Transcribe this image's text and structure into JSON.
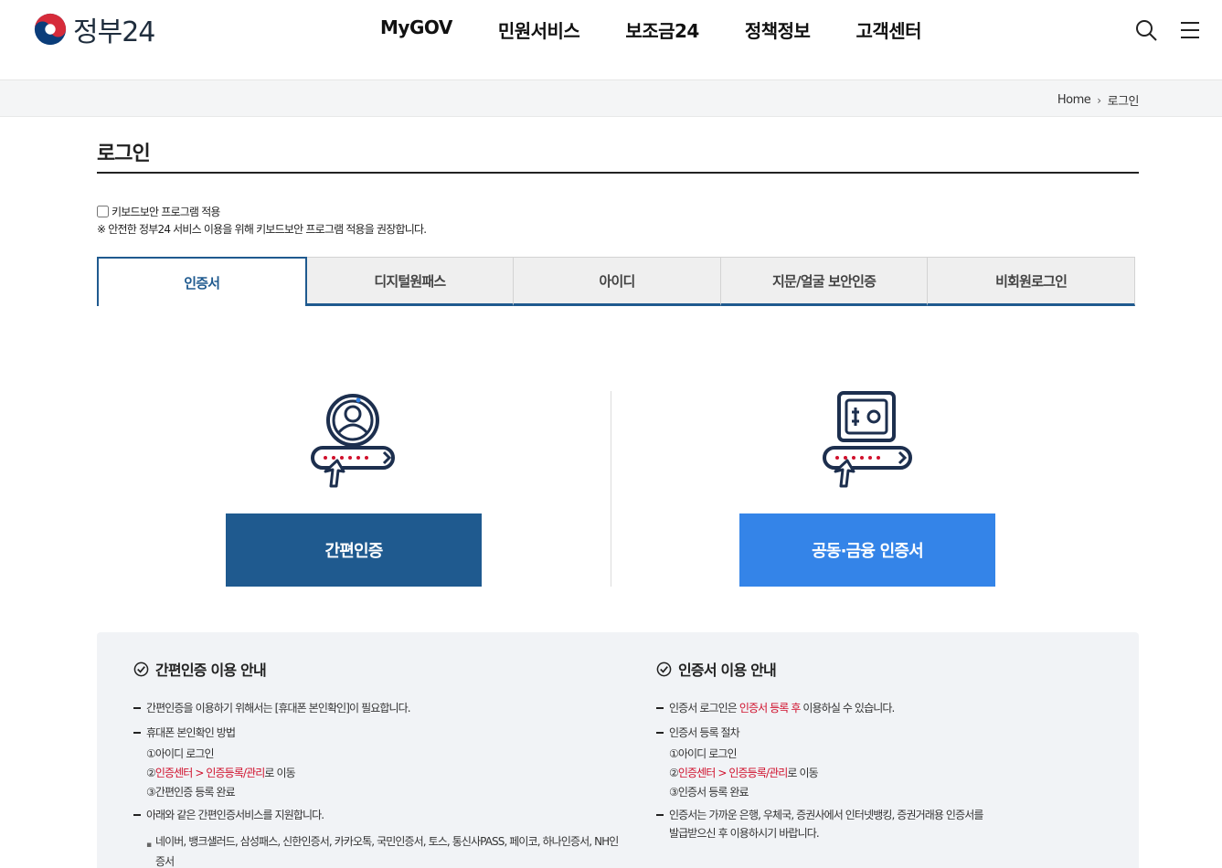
{
  "header": {
    "logo_text": "정부24",
    "nav": [
      "MyGOV",
      "민원서비스",
      "보조금24",
      "정책정보",
      "고객센터"
    ],
    "icons": [
      "search-icon",
      "menu-icon"
    ]
  },
  "breadcrumb": {
    "home": "Home",
    "current": "로그인"
  },
  "page": {
    "title": "로그인"
  },
  "keyboard_security": {
    "label": "키보드보안 프로그램 적용",
    "checked": false,
    "note": "※ 안전한 정부24 서비스 이용을 위해 키보드보안 프로그램 적용을 권장합니다."
  },
  "tabs": [
    {
      "label": "인증서",
      "active": true
    },
    {
      "label": "디지털원패스",
      "active": false
    },
    {
      "label": "아이디",
      "active": false
    },
    {
      "label": "지문/얼굴 보안인증",
      "active": false
    },
    {
      "label": "비회원로그인",
      "active": false
    }
  ],
  "options": {
    "simple": {
      "label": "간편인증",
      "icon": "user-password-icon",
      "color": "#1f5a8f"
    },
    "cert": {
      "label": "공동·금융 인증서",
      "icon": "safe-password-icon",
      "color": "#3484e8"
    }
  },
  "info": {
    "simple": {
      "title": "간편인증 이용 안내",
      "l1": "간편인증을 이용하기 위해서는 [휴대폰 본인확인]이 필요합니다.",
      "l2": "휴대폰 본인확인 방법",
      "s1": "①아이디 로그인",
      "s2_pre": "②",
      "s2_red": "인증센터 > 인증등록/관리",
      "s2_post": "로 이동",
      "s3": "③간편인증 등록 완료",
      "l3": "아래와 같은 간편인증서비스를 지원합니다.",
      "d1": "네이버, 뱅크샐러드, 삼성패스, 신한인증서, 카카오톡, 국민인증서, 토스, 통신사PASS, 페이코, 하나인증서, NH인증서"
    },
    "cert": {
      "title": "인증서 이용 안내",
      "l1_pre": "인증서 로그인은 ",
      "l1_red": "인증서 등록 후",
      "l1_post": " 이용하실 수 있습니다.",
      "l2": "인증서 등록 절차",
      "s1": "①아이디 로그인",
      "s2_pre": "②",
      "s2_red": "인증센터 > 인증등록/관리",
      "s2_post": "로 이동",
      "s3": "③인증서 등록 완료",
      "l3a": "인증서는 가까운 은행, 우체국, 증권사에서 인터넷뱅킹, 증권거래용 인증서를",
      "l3b": "발급받으신 후 이용하시기 바랍니다."
    }
  },
  "colors": {
    "primary": "#1f5a8f",
    "accent": "#3484e8",
    "highlight": "#d0102c"
  }
}
